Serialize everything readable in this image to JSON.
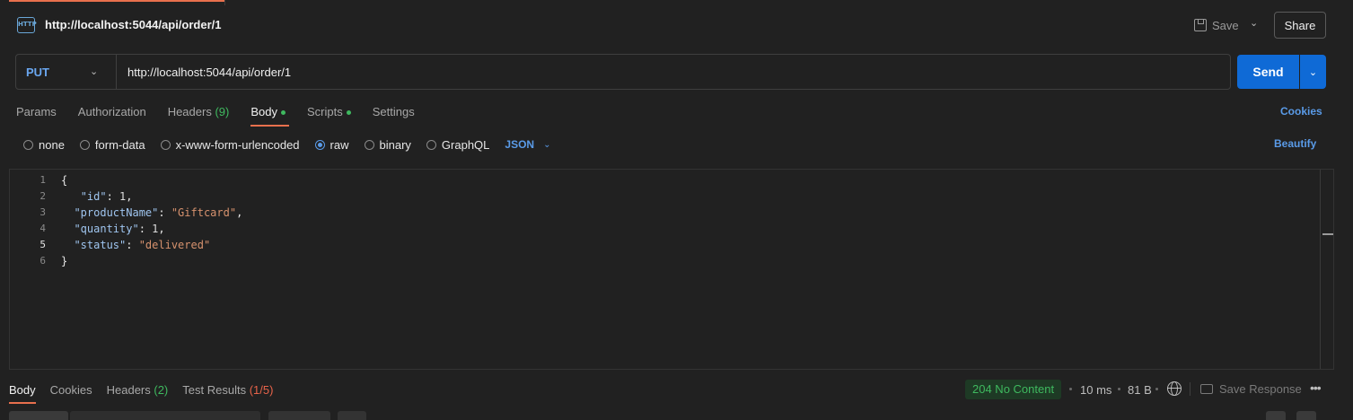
{
  "request": {
    "title": "http://localhost:5044/api/order/1",
    "icon_text": "HTTP",
    "save_label": "Save",
    "share_label": "Share",
    "method": "PUT",
    "url": "http://localhost:5044/api/order/1",
    "send_label": "Send"
  },
  "request_tabs": {
    "params": "Params",
    "authorization": "Authorization",
    "headers": "Headers",
    "headers_count": "(9)",
    "body": "Body",
    "scripts": "Scripts",
    "settings": "Settings",
    "cookies": "Cookies"
  },
  "body_types": {
    "none": "none",
    "form_data": "form-data",
    "urlencoded": "x-www-form-urlencoded",
    "raw": "raw",
    "binary": "binary",
    "graphql": "GraphQL",
    "format": "JSON",
    "beautify": "Beautify"
  },
  "editor": {
    "line_numbers": [
      "1",
      "2",
      "3",
      "4",
      "5",
      "6"
    ],
    "lines": [
      {
        "parts": [
          {
            "t": "plain",
            "v": "{"
          }
        ]
      },
      {
        "parts": [
          {
            "t": "plain",
            "v": "   "
          },
          {
            "t": "key",
            "v": "\"id\""
          },
          {
            "t": "plain",
            "v": ": "
          },
          {
            "t": "num",
            "v": "1"
          },
          {
            "t": "plain",
            "v": ","
          }
        ]
      },
      {
        "parts": [
          {
            "t": "plain",
            "v": "  "
          },
          {
            "t": "key",
            "v": "\"productName\""
          },
          {
            "t": "plain",
            "v": ": "
          },
          {
            "t": "str",
            "v": "\"Giftcard\""
          },
          {
            "t": "plain",
            "v": ","
          }
        ]
      },
      {
        "parts": [
          {
            "t": "plain",
            "v": "  "
          },
          {
            "t": "key",
            "v": "\"quantity\""
          },
          {
            "t": "plain",
            "v": ": "
          },
          {
            "t": "num",
            "v": "1"
          },
          {
            "t": "plain",
            "v": ","
          }
        ]
      },
      {
        "parts": [
          {
            "t": "plain",
            "v": "  "
          },
          {
            "t": "key",
            "v": "\"status\""
          },
          {
            "t": "plain",
            "v": ": "
          },
          {
            "t": "str",
            "v": "\"delivered\""
          }
        ]
      },
      {
        "parts": [
          {
            "t": "plain",
            "v": "}"
          }
        ]
      }
    ]
  },
  "response": {
    "tab_body": "Body",
    "tab_cookies": "Cookies",
    "tab_headers": "Headers",
    "headers_count": "(2)",
    "tab_tests": "Test Results",
    "tests_count": "(1/5)",
    "status": "204 No Content",
    "time": "10 ms",
    "size": "81 B",
    "save_response": "Save Response",
    "more": "•••"
  },
  "colors": {
    "accent": "#e8704d",
    "primary": "#0f6ad6",
    "link": "#5a9be8",
    "success": "#3fb95f",
    "error": "#e8634a"
  }
}
